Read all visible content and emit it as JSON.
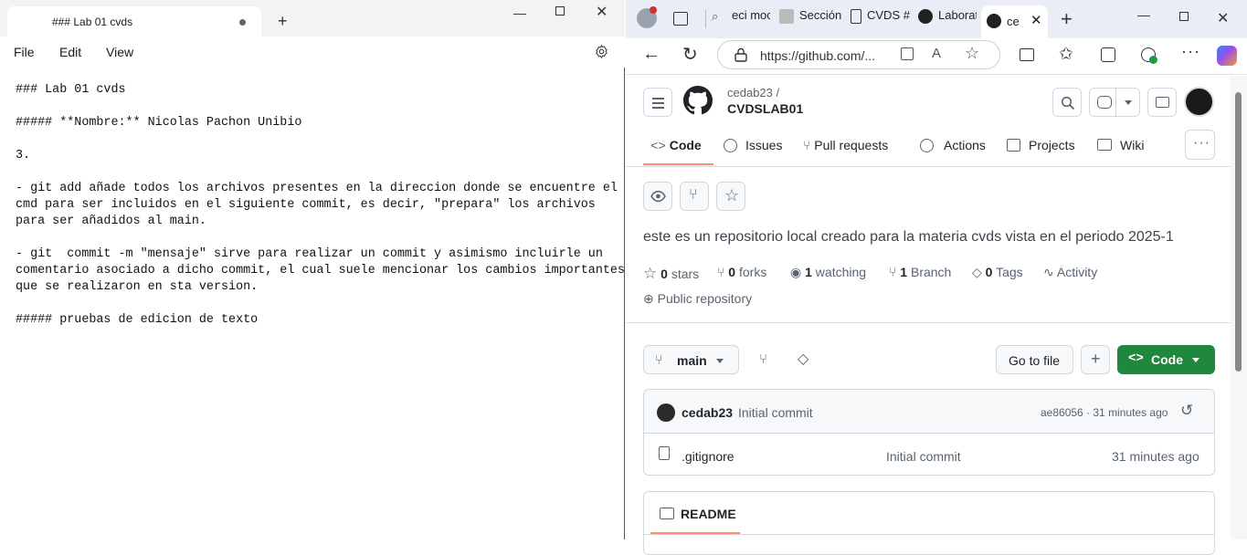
{
  "notepad": {
    "tab_title": "### Lab 01 cvds",
    "new_tab": "+",
    "menu": [
      "File",
      "Edit",
      "View"
    ],
    "lines": [
      "### Lab 01 cvds",
      "",
      "##### **Nombre:** Nicolas Pachon Unibio",
      "",
      "3.",
      "",
      "- git add añade todos los archivos presentes en la direccion donde se encuentre el",
      "cmd para ser incluidos en el siguiente commit, es decir, \"prepara\" los archivos",
      "para ser añadidos al main.",
      "",
      "- git  commit -m \"mensaje\" sirve para realizar un commit y asimismo incluirle un",
      "comentario asociado a dicho commit, el cual suele mencionar los cambios importantes",
      "que se realizaron en sta version.",
      "",
      "##### pruebas de edicion de texto"
    ]
  },
  "browser": {
    "tabs": [
      {
        "label": "eci moc",
        "icon": "search-icon"
      },
      {
        "label": "Sección",
        "icon": "page-icon"
      },
      {
        "label": "CVDS #",
        "icon": "document-icon"
      },
      {
        "label": "Laborat",
        "icon": "github-icon"
      },
      {
        "label": "ce",
        "icon": "github-icon",
        "active": true
      }
    ],
    "url": "https://github.com/...",
    "new_tab": "+"
  },
  "github": {
    "owner": "cedab23 /",
    "repo": "CVDSLAB01",
    "nav": [
      {
        "label": "Code",
        "icon": "code-icon",
        "active": true
      },
      {
        "label": "Issues",
        "icon": "issue-icon"
      },
      {
        "label": "Pull requests",
        "icon": "pull-request-icon"
      },
      {
        "label": "Actions",
        "icon": "play-icon"
      },
      {
        "label": "Projects",
        "icon": "table-icon"
      },
      {
        "label": "Wiki",
        "icon": "book-icon"
      }
    ],
    "description": "este es un repositorio local creado para la materia cvds vista en el periodo 2025-1",
    "stats": [
      {
        "count": "0",
        "label": "stars"
      },
      {
        "count": "0",
        "label": "forks"
      },
      {
        "count": "1",
        "label": "watching"
      },
      {
        "count": "1",
        "label": "Branch"
      },
      {
        "count": "0",
        "label": "Tags"
      },
      {
        "count": "",
        "label": "Activity"
      }
    ],
    "visibility": "Public repository",
    "branch": "main",
    "go_to_file": "Go to file",
    "add": "+",
    "code_btn": "Code",
    "commit": {
      "author": "cedab23",
      "message": "Initial commit",
      "meta": "ae86056 · 31 minutes ago"
    },
    "files": [
      {
        "name": ".gitignore",
        "message": "Initial commit",
        "time": "31 minutes ago"
      }
    ],
    "readme": "README",
    "accent": "#1f883d",
    "tab_underline": "#fd8c73"
  }
}
